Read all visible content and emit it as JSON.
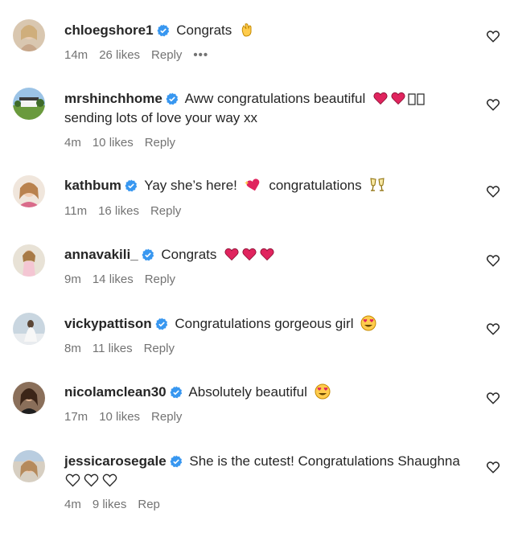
{
  "colors": {
    "verified": "#3897f0",
    "meta": "#737373",
    "text": "#262626",
    "heart_red": "#e0245e"
  },
  "comments": [
    {
      "username": "chloegshore1",
      "text": "Congrats",
      "time": "14m",
      "likes": "26 likes",
      "reply": "Reply",
      "more": "•••",
      "emojis": [
        "clapping-hands"
      ]
    },
    {
      "username": "mrshinchhome",
      "text": "Aww congratulations beautiful",
      "text2": "sending lots of love your way xx",
      "time": "4m",
      "likes": "10 likes",
      "reply": "Reply",
      "emojis": [
        "red-heart",
        "red-heart",
        "placeholder-box",
        "placeholder-box"
      ]
    },
    {
      "username": "kathbum",
      "text": "Yay she’s here!",
      "text_after": "congratulations",
      "time": "11m",
      "likes": "16 likes",
      "reply": "Reply",
      "emojis": [
        "sparkling-heart",
        "clinking-glasses"
      ]
    },
    {
      "username": "annavakili_",
      "text": "Congrats",
      "time": "9m",
      "likes": "14 likes",
      "reply": "Reply",
      "emojis": [
        "red-heart",
        "red-heart",
        "red-heart"
      ]
    },
    {
      "username": "vickypattison",
      "text": "Congratulations gorgeous girl",
      "time": "8m",
      "likes": "11 likes",
      "reply": "Reply",
      "emojis": [
        "heart-eyes-face"
      ]
    },
    {
      "username": "nicolamclean30",
      "text": "Absolutely beautiful",
      "time": "17m",
      "likes": "10 likes",
      "reply": "Reply",
      "emojis": [
        "heart-eyes-face"
      ]
    },
    {
      "username": "jessicarosegale",
      "text": "She is the cutest! Congratulations Shaughna",
      "time": "4m",
      "likes": "9 likes",
      "reply": "Rep",
      "emojis": [
        "white-heart",
        "white-heart",
        "white-heart"
      ]
    }
  ]
}
